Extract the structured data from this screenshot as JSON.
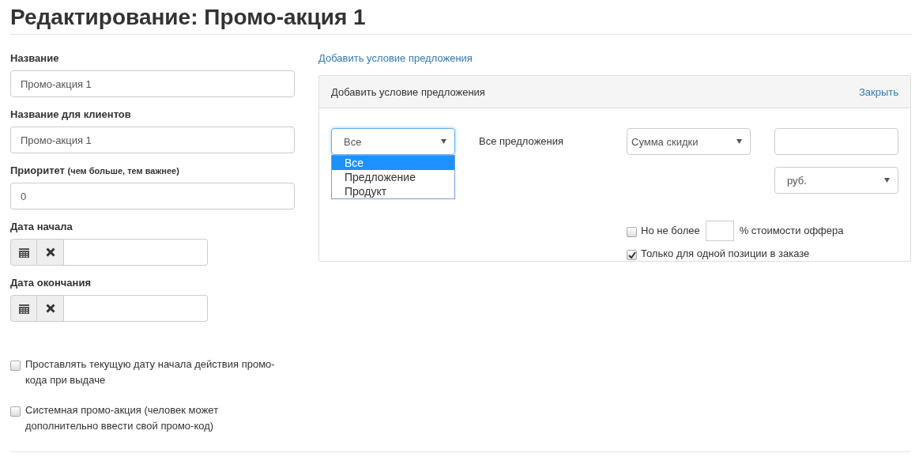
{
  "title": "Редактирование: Промо-акция 1",
  "form": {
    "fields": [
      {
        "kind": "text",
        "label": "Название",
        "value": "Промо-акция 1"
      },
      {
        "kind": "text",
        "label": "Название для клиентов",
        "value": "Промо-акция 1"
      },
      {
        "kind": "text",
        "label": "Приоритет",
        "hint": "(чем больше, тем важнее)",
        "value": "0"
      },
      {
        "kind": "date",
        "label": "Дата начала"
      },
      {
        "kind": "date",
        "label": "Дата окончания"
      }
    ],
    "checkboxes": [
      {
        "label": "Проставлять текущую дату начала действия промо-кода при выдаче",
        "checked": false
      },
      {
        "label": "Системная промо-акция (человек может дополнительно ввести свой промо-код)",
        "checked": false
      }
    ]
  },
  "condition": {
    "link": "Добавить условие предложения",
    "panel_title": "Добавить условие предложения",
    "close": "Закрыть",
    "scope_select": {
      "value": "Все",
      "expanded": true,
      "options": [
        {
          "label": "Все",
          "selected": true
        },
        {
          "label": "Предложение",
          "selected": false
        },
        {
          "label": "Продукт",
          "selected": false
        }
      ]
    },
    "scope_text": "Все предложения",
    "discount_select": {
      "value": "Сумма скидки"
    },
    "currency_select": {
      "value": "руб."
    },
    "limit": {
      "checked": false,
      "before": "Но не более",
      "after": "% стоимости оффера"
    },
    "single": {
      "checked": true,
      "label": "Только для одной позиции в заказе"
    }
  }
}
